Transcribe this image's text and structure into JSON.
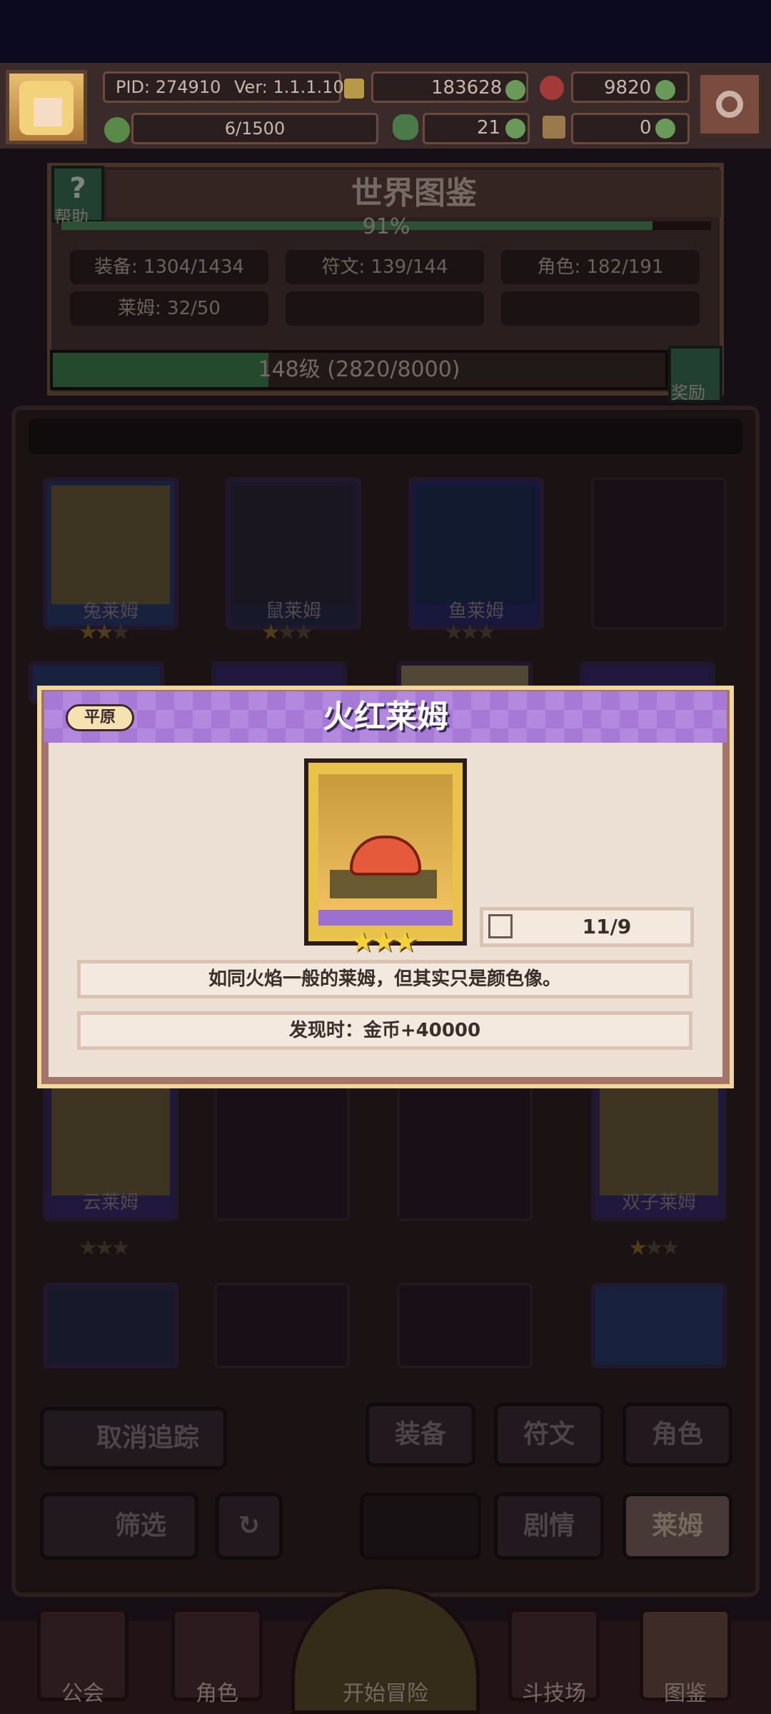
{
  "top": {
    "pid": "PID: 274910",
    "version": "Ver: 1.1.1.10",
    "gold": "183628",
    "gems": "9820",
    "stamina": "6/1500",
    "clover": "21",
    "ticket": "0"
  },
  "codex": {
    "title": "世界图鉴",
    "help_label": "帮助",
    "percent": "91%",
    "percent_value": 0.91,
    "stats": [
      {
        "label": "装备: 1304/1434"
      },
      {
        "label": "符文: 139/144"
      },
      {
        "label": "角色: 182/191"
      },
      {
        "label": "莱姆: 32/50"
      }
    ],
    "level": "148级  (2820/8000)",
    "level_progress": 0.3525,
    "reward_label": "奖励"
  },
  "grid": {
    "row1": [
      "兔莱姆",
      "鼠莱姆",
      "鱼莱姆"
    ],
    "row3": [
      "云莱姆",
      "双子莱姆"
    ]
  },
  "controls": {
    "untrack": "取消追踪",
    "filter": "筛选",
    "tabs_row1": [
      "装备",
      "符文",
      "角色"
    ],
    "tabs_row2": [
      "剧情",
      "莱姆"
    ]
  },
  "nav": [
    "公会",
    "角色",
    "开始冒险",
    "斗技场",
    "图鉴"
  ],
  "dialog": {
    "tag": "平原",
    "title": "火红莱姆",
    "count": "11/9",
    "description": "如同火焰一般的莱姆，但其实只是颜色像。",
    "discover": "发现时：金币+40000",
    "stars": "★★★"
  }
}
